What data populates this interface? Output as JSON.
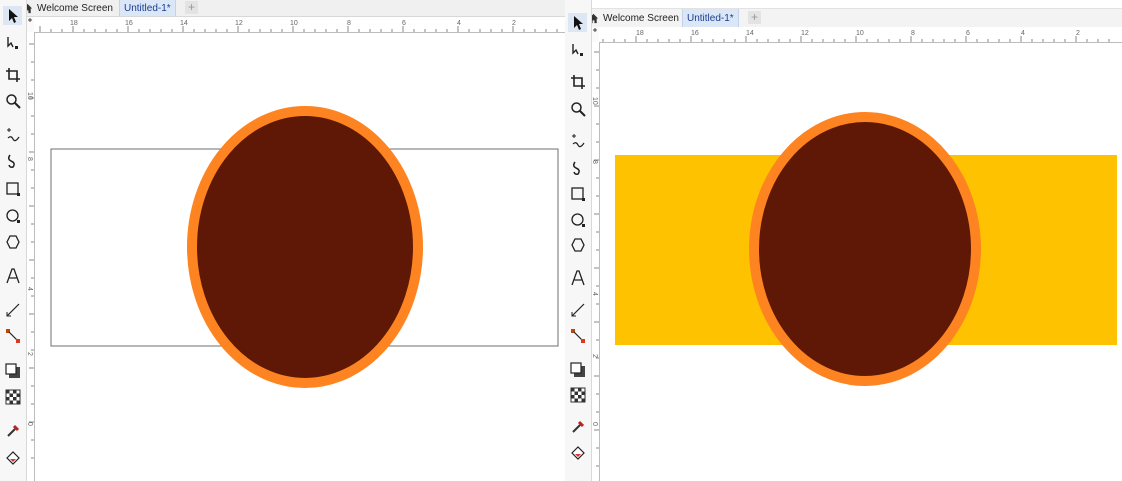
{
  "left_window": {
    "tabs": {
      "welcome": "Welcome Screen",
      "document": "Untitled-1*"
    },
    "ruler_labels": [
      "18",
      "16",
      "14",
      "12",
      "10",
      "8",
      "6",
      "4",
      "2"
    ],
    "vertical_ruler_labels": [
      "10",
      "8",
      "4",
      "2",
      "0"
    ],
    "rectangle": {
      "fill": "none",
      "outline": "#6f6f6f"
    },
    "ellipse": {
      "fill": "#5e1805",
      "outline": "#fd8420"
    }
  },
  "right_window": {
    "tabs": {
      "welcome": "Welcome Screen",
      "document": "Untitled-1*"
    },
    "ruler_labels": [
      "18",
      "16",
      "14",
      "12",
      "10",
      "8",
      "6",
      "4",
      "2"
    ],
    "vertical_ruler_labels": [
      "10",
      "8",
      "4",
      "2",
      "0"
    ],
    "rectangle": {
      "fill": "#fec200",
      "outline": "none"
    },
    "ellipse": {
      "fill": "#5e1805",
      "outline": "#fd8420"
    }
  },
  "tools": [
    "pick-tool",
    "shape-tool",
    "crop-tool",
    "zoom-tool",
    "freehand-tool",
    "artistic-media-tool",
    "rectangle-tool",
    "ellipse-tool",
    "polygon-tool",
    "text-tool",
    "dimension-tool",
    "connector-tool",
    "drop-shadow-tool",
    "transparency-tool",
    "eyedropper-tool",
    "interactive-fill-tool"
  ],
  "colors": {
    "accent": "#1a3d8f",
    "ruler_bg": "#ffffff",
    "workspace": "#ffffff"
  }
}
